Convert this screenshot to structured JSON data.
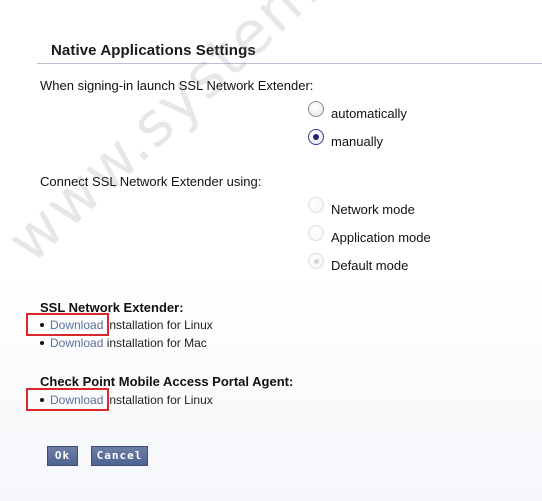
{
  "page": {
    "title": "Native Applications Settings",
    "watermark": "www.systemmen.com"
  },
  "launch": {
    "prompt": "When signing-in launch SSL Network Extender:",
    "options": [
      {
        "label": "automatically",
        "selected": false,
        "enabled": true
      },
      {
        "label": "manually",
        "selected": true,
        "enabled": true
      }
    ]
  },
  "connect": {
    "prompt": "Connect SSL Network Extender using:",
    "options": [
      {
        "label": "Network mode",
        "selected": false,
        "enabled": false
      },
      {
        "label": "Application mode",
        "selected": false,
        "enabled": false
      },
      {
        "label": "Default mode",
        "selected": true,
        "enabled": false
      }
    ]
  },
  "snx": {
    "heading": "SSL Network Extender:",
    "items": [
      {
        "link": "Download",
        "text": " installation for Linux"
      },
      {
        "link": "Download",
        "text": " installation for Mac"
      }
    ]
  },
  "agent": {
    "heading": "Check Point Mobile Access Portal Agent:",
    "items": [
      {
        "link": "Download",
        "text": " installation for Linux"
      }
    ]
  },
  "buttons": {
    "ok": "Ok",
    "cancel": "Cancel"
  },
  "colors": {
    "button": "#5a6d98",
    "link": "#5a6f9c",
    "highlight": "#d8282b",
    "rule": "#b9c3d6"
  }
}
